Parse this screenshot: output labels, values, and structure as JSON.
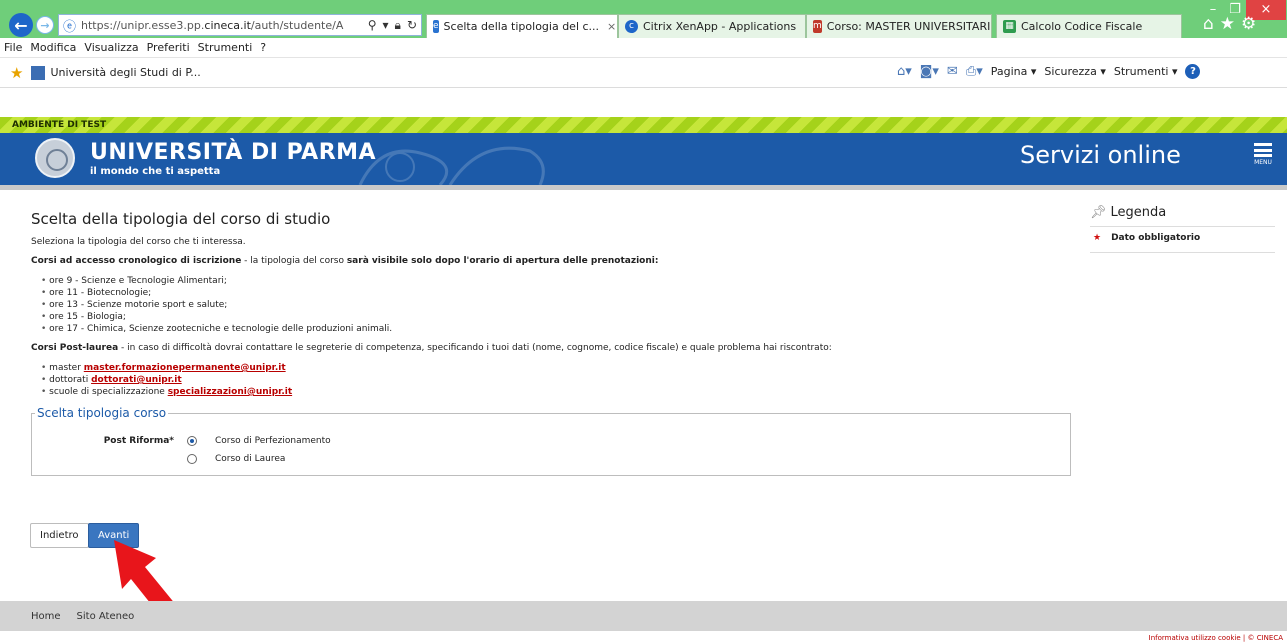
{
  "browser": {
    "url_host": "https://unipr.esse3.pp.",
    "url_domain": "cineca.it",
    "url_path": "/auth/studente/A",
    "tabs": [
      {
        "label": "Scelta della tipologia del c...",
        "close": "×"
      },
      {
        "label": "Citrix XenApp - Applications"
      },
      {
        "label": "Corso: MASTER UNIVERSITARI"
      },
      {
        "label": "Calcolo Codice Fiscale"
      }
    ],
    "menu": [
      "File",
      "Modifica",
      "Visualizza",
      "Preferiti",
      "Strumenti",
      "?"
    ],
    "favorite": "Università degli Studi di P...",
    "commands": {
      "pagina": "Pagina ▾",
      "sicurezza": "Sicurezza ▾",
      "strumenti": "Strumenti ▾"
    },
    "window_controls": {
      "minimize": "–",
      "maximize": "❐",
      "close": "×"
    }
  },
  "env_banner": "AMBIENTE DI TEST",
  "header": {
    "university": "UNIVERSITÀ DI PARMA",
    "tagline": "il mondo che ti aspetta",
    "servizi": "Servizi online",
    "menu_label": "MENU"
  },
  "main": {
    "title": "Scelta della tipologia del corso di studio",
    "intro": "Seleziona la tipologia del corso che ti interessa.",
    "crono": {
      "bold1": "Corsi ad accesso cronologico di iscrizione",
      "text": " - la tipologia del corso ",
      "bold2": "sarà visibile solo dopo l'orario di apertura delle prenotazioni:",
      "items": [
        "ore 9 - Scienze e Tecnologie Alimentari;",
        "ore 11 - Biotecnologie;",
        "ore 13 - Scienze motorie sport e salute;",
        "ore 15 - Biologia;",
        "ore 17 - Chimica, Scienze zootecniche e tecnologie delle produzioni animali."
      ]
    },
    "post": {
      "bold": "Corsi Post-laurea",
      "text": " - in caso di difficoltà dovrai contattare le segreterie di competenza, specificando i tuoi dati (nome, cognome, codice fiscale) e quale problema hai riscontrato:",
      "contacts": [
        {
          "prefix": "master ",
          "email": "master.formazionepermanente@unipr.it"
        },
        {
          "prefix": "dottorati ",
          "email": "dottorati@unipr.it"
        },
        {
          "prefix": "scuole di specializzazione ",
          "email": "specializzazioni@unipr.it"
        }
      ]
    },
    "fieldset": {
      "legend": "Scelta tipologia corso",
      "label": "Post Riforma*",
      "options": [
        "Corso di Perfezionamento",
        "Corso di Laurea"
      ],
      "selected": 0
    },
    "buttons": {
      "back": "Indietro",
      "next": "Avanti"
    }
  },
  "legenda": {
    "title": "Legenda",
    "required": "Dato obbligatorio",
    "required_symbol": "★"
  },
  "footer": {
    "links": [
      "Home",
      "Sito Ateneo"
    ],
    "copyright": "Informativa utilizzo cookie | © CINECA"
  }
}
